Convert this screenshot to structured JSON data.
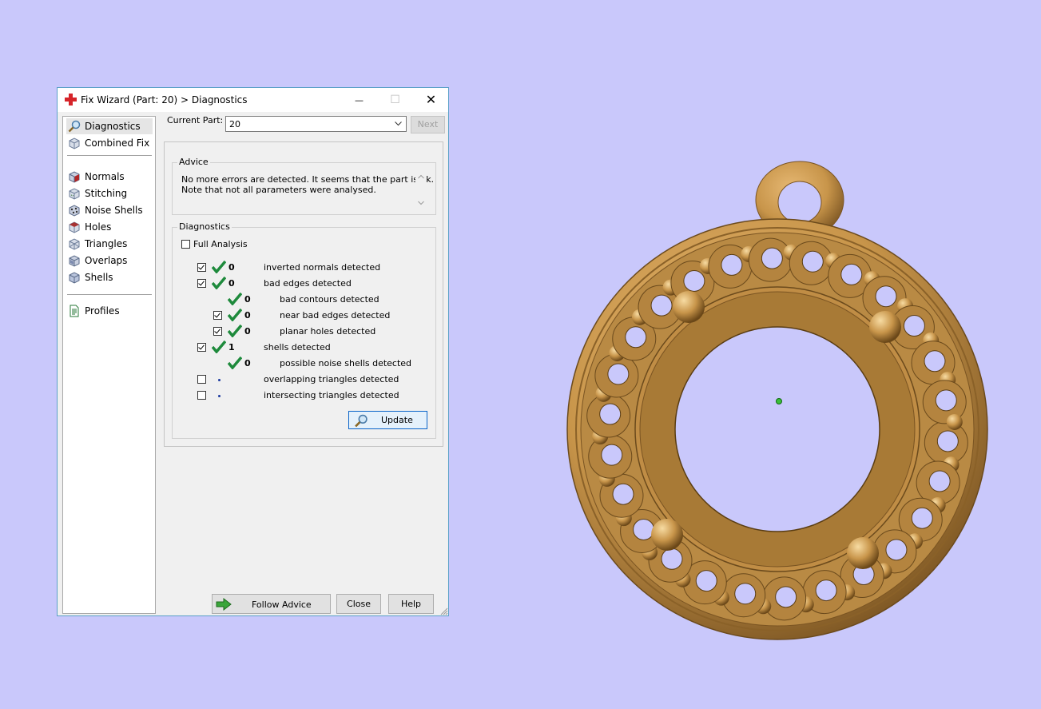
{
  "window": {
    "title": "Fix Wizard (Part: 20) > Diagnostics",
    "minimize_glyph": "—",
    "maximize_glyph": "☐",
    "close_glyph": "✕"
  },
  "nav": {
    "items": [
      {
        "label": "Diagnostics",
        "icon": "magnifier-icon"
      },
      {
        "label": "Combined Fix",
        "icon": "cube-icon"
      },
      {
        "label": "Normals",
        "icon": "normals-cube-icon"
      },
      {
        "label": "Stitching",
        "icon": "stitching-cube-icon"
      },
      {
        "label": "Noise Shells",
        "icon": "noise-shells-icon"
      },
      {
        "label": "Holes",
        "icon": "holes-cube-icon"
      },
      {
        "label": "Triangles",
        "icon": "triangles-cube-icon"
      },
      {
        "label": "Overlaps",
        "icon": "overlaps-cube-icon"
      },
      {
        "label": "Shells",
        "icon": "shells-cube-icon"
      },
      {
        "label": "Profiles",
        "icon": "profile-document-icon"
      }
    ]
  },
  "current_part": {
    "label": "Current Part:",
    "value": "20",
    "next_label": "Next"
  },
  "advice": {
    "title": "Advice",
    "line1": "No more errors are detected. It seems that the part is ok.",
    "line2": "Note that not all parameters were analysed."
  },
  "diagnostics": {
    "title": "Diagnostics",
    "full_analysis_label": "Full Analysis",
    "rows": [
      {
        "checked": true,
        "count": "0",
        "label": "inverted normals detected",
        "status": "check"
      },
      {
        "checked": true,
        "count": "0",
        "label": "bad edges detected",
        "status": "check"
      },
      {
        "checked": null,
        "count": "0",
        "label": "bad contours detected",
        "status": "check"
      },
      {
        "checked": true,
        "count": "0",
        "label": "near bad edges detected",
        "status": "check"
      },
      {
        "checked": true,
        "count": "0",
        "label": "planar holes detected",
        "status": "check"
      },
      {
        "checked": true,
        "count": "1",
        "label": "shells detected",
        "status": "check"
      },
      {
        "checked": null,
        "count": "0",
        "label": "possible noise shells detected",
        "status": "check"
      },
      {
        "checked": false,
        "count": "",
        "label": "overlapping triangles detected",
        "status": "dot"
      },
      {
        "checked": false,
        "count": "",
        "label": "intersecting triangles detected",
        "status": "dot"
      }
    ],
    "update_label": "Update"
  },
  "footer": {
    "follow_advice_label": "Follow Advice",
    "close_label": "Close",
    "help_label": "Help"
  },
  "colors": {
    "background": "#c9c8fb",
    "pendant_gold": "#c8954a",
    "check_green": "#1e8a3c"
  }
}
